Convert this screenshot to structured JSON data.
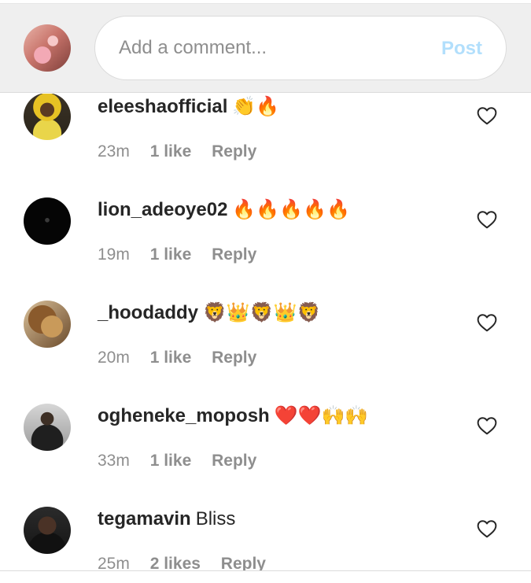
{
  "composer": {
    "placeholder": "Add a comment...",
    "post_label": "Post"
  },
  "comments": [
    {
      "username": "eleeshaofficial",
      "text": "👏🔥",
      "time": "23m",
      "likes": "1 like",
      "reply": "Reply"
    },
    {
      "username": "lion_adeoye02",
      "text": "🔥🔥🔥🔥🔥",
      "time": "19m",
      "likes": "1 like",
      "reply": "Reply"
    },
    {
      "username": "_hoodaddy",
      "text": "🦁👑🦁👑🦁",
      "time": "20m",
      "likes": "1 like",
      "reply": "Reply"
    },
    {
      "username": "ogheneke_moposh",
      "text": "❤️❤️🙌🙌",
      "time": "33m",
      "likes": "1 like",
      "reply": "Reply"
    },
    {
      "username": "tegamavin",
      "text": "Bliss",
      "time": "25m",
      "likes": "2 likes",
      "reply": "Reply"
    }
  ],
  "colors": {
    "post_disabled": "#b2dffc",
    "meta_gray": "#8e8e8e",
    "composer_bg": "#efefef"
  },
  "icons": {
    "like": "heart-outline-icon"
  }
}
